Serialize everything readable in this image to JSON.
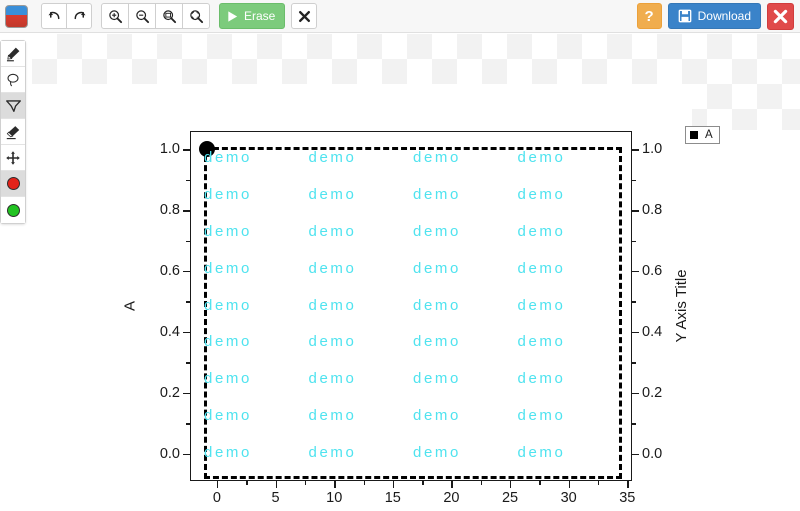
{
  "app": {
    "logo_icon": "app-logo-icon"
  },
  "toolbar": {
    "undo": {
      "label": "Undo",
      "icon": "undo-icon"
    },
    "redo": {
      "label": "Redo",
      "icon": "redo-icon"
    },
    "zoom_in": {
      "label": "Zoom In",
      "icon": "zoom-in-icon"
    },
    "zoom_out": {
      "label": "Zoom Out",
      "icon": "zoom-out-icon"
    },
    "zoom_actual": {
      "label": "Zoom 1:1",
      "icon": "zoom-actual-size-icon"
    },
    "zoom_fit": {
      "label": "Zoom To Fit",
      "icon": "zoom-fit-icon"
    },
    "erase": {
      "label": "Erase",
      "icon": "play-icon"
    },
    "cancel": {
      "label": "Cancel",
      "icon": "x-icon"
    },
    "help": {
      "label": "?",
      "icon": "help-icon"
    },
    "download": {
      "label": "Download",
      "icon": "floppy-disk-icon"
    },
    "close": {
      "label": "Close",
      "icon": "close-x-icon"
    }
  },
  "rail": {
    "items": [
      {
        "name": "marker-tool",
        "label": "Marker",
        "icon": "marker-pen-icon",
        "active": false
      },
      {
        "name": "lasso-tool",
        "label": "Lasso Select",
        "icon": "lasso-icon",
        "active": false
      },
      {
        "name": "polygon-tool",
        "label": "Polygon Select",
        "icon": "polygon-select-icon",
        "active": true
      },
      {
        "name": "eraser-tool",
        "label": "Eraser",
        "icon": "eraser-icon",
        "active": false
      },
      {
        "name": "move-tool",
        "label": "Move",
        "icon": "move-arrows-icon",
        "active": false
      }
    ],
    "colors": [
      {
        "name": "color-red",
        "label": "Red",
        "hex": "#e2231a",
        "active": true
      },
      {
        "name": "color-green",
        "label": "Green",
        "hex": "#22c322",
        "active": false
      }
    ]
  },
  "legend": {
    "marker_color": "#000000",
    "entries": [
      "A"
    ]
  },
  "chart_data": {
    "type": "scatter",
    "title": "",
    "xlabel": "",
    "ylabel": "A",
    "y2label": "Y Axis Title",
    "xlim": [
      -2.3,
      35.4
    ],
    "ylim": [
      -0.09,
      1.06
    ],
    "xticks": [
      0,
      5,
      10,
      15,
      20,
      25,
      30,
      35
    ],
    "xtick_labels": [
      "0",
      "5",
      "10",
      "15",
      "20",
      "25",
      "30",
      "35"
    ],
    "yticks": [
      0.0,
      0.2,
      0.4,
      0.6,
      0.8,
      1.0
    ],
    "ytick_labels": [
      "0.0",
      "0.2",
      "0.4",
      "0.6",
      "0.8",
      "1.0"
    ],
    "y2ticks": [
      0.0,
      0.2,
      0.4,
      0.6,
      0.8,
      1.0
    ],
    "y2tick_labels": [
      "0.0",
      "0.2",
      "0.4",
      "0.6",
      "0.8",
      "1.0"
    ],
    "minor_ticks": true,
    "grid": false,
    "legend_position": "outside-top-right",
    "series": [
      {
        "name": "A",
        "marker": "square",
        "color": "#000000",
        "values": []
      }
    ],
    "annotations": {
      "text": "demo",
      "color": "#4fe3ef",
      "rows": 9,
      "columns": 4,
      "count": 36
    }
  },
  "selection": {
    "name": "dashed-selection-box",
    "style": "dashed",
    "color": "#000000",
    "handle": "top-left"
  }
}
